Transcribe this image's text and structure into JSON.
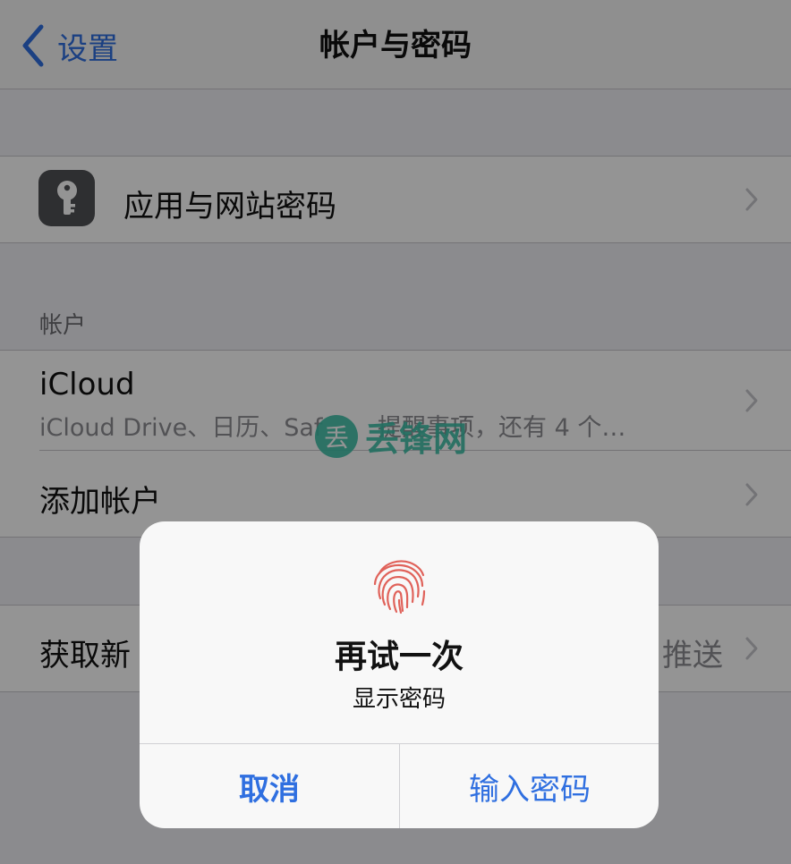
{
  "nav": {
    "back_label": "设置",
    "title": "帐户与密码"
  },
  "passwords_row": {
    "label": "应用与网站密码",
    "icon": "key-icon"
  },
  "accounts_section": {
    "header": "帐户"
  },
  "icloud_row": {
    "label": "iCloud",
    "subtitle": "iCloud Drive、日历、Saf",
    "subtitle_tail": "提醒事项，还有 4 个…"
  },
  "add_account_row": {
    "label": "添加帐户"
  },
  "fetch_row": {
    "label": "获取新",
    "value": "推送"
  },
  "watermark": {
    "glyph": "丢",
    "text": "丢锋网"
  },
  "alert": {
    "icon": "fingerprint-icon",
    "title": "再试一次",
    "message": "显示密码",
    "cancel_label": "取消",
    "confirm_label": "输入密码"
  },
  "colors": {
    "accent": "#2f6fe0",
    "fingerprint": "#e0625a",
    "watermark": "#3bbfa7"
  }
}
